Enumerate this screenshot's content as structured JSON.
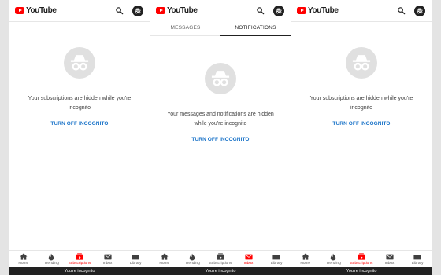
{
  "app": {
    "name": "YouTube"
  },
  "colors": {
    "brand_red": "#ff0000",
    "link_blue": "#1a73c8",
    "dark": "#212121"
  },
  "panels": [
    {
      "message": "Your subscriptions are hidden while you're incognito",
      "action": "TURN OFF INCOGNITO",
      "active_nav": "Subscriptions"
    },
    {
      "tabs": [
        {
          "label": "MESSAGES",
          "active": false
        },
        {
          "label": "NOTIFICATIONS",
          "active": true
        }
      ],
      "message": "Your messages and notifications are hidden while you're incognito",
      "action": "TURN OFF INCOGNITO",
      "active_nav": "Inbox"
    },
    {
      "message": "Your subscriptions are hidden while you're incognito",
      "action": "TURN OFF INCOGNITO",
      "active_nav": "Subscriptions"
    }
  ],
  "nav": [
    {
      "label": "Home",
      "icon": "home-icon"
    },
    {
      "label": "Trending",
      "icon": "flame-icon"
    },
    {
      "label": "Subscriptions",
      "icon": "subscriptions-icon"
    },
    {
      "label": "Inbox",
      "icon": "inbox-icon"
    },
    {
      "label": "Library",
      "icon": "library-icon"
    }
  ],
  "status_bar": "You're incognito"
}
